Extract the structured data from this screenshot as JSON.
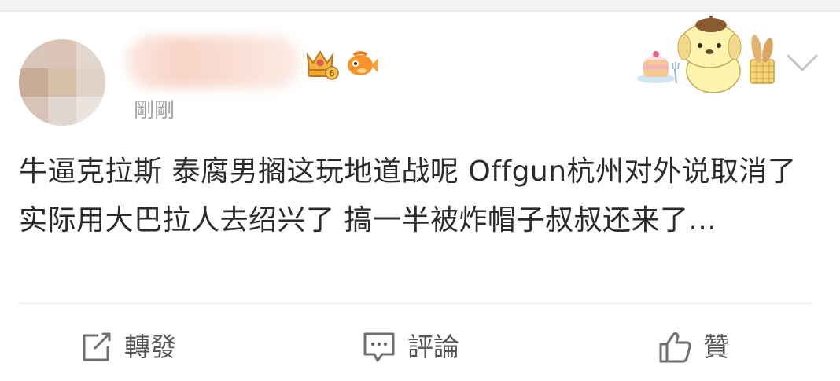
{
  "post": {
    "timestamp": "剛剛",
    "text": "牛逼克拉斯 泰腐男搁这玩地道战呢 Offgun杭州对外说取消了 实际用大巴拉人去绍兴了 搞一半被炸帽子叔叔还来了..."
  },
  "user_badges": {
    "crown_level": "6"
  },
  "actions": {
    "repost_label": "轉發",
    "comment_label": "評論",
    "like_label": "贊"
  },
  "icons": {
    "repost": "share-square-icon",
    "comment": "comment-bubble-icon",
    "like": "thumbs-up-icon",
    "more": "chevron-down-icon"
  },
  "colors": {
    "text": "#2b2b2b",
    "muted": "#a3a3a3",
    "action": "#555555",
    "divider": "#e9e9e9"
  }
}
